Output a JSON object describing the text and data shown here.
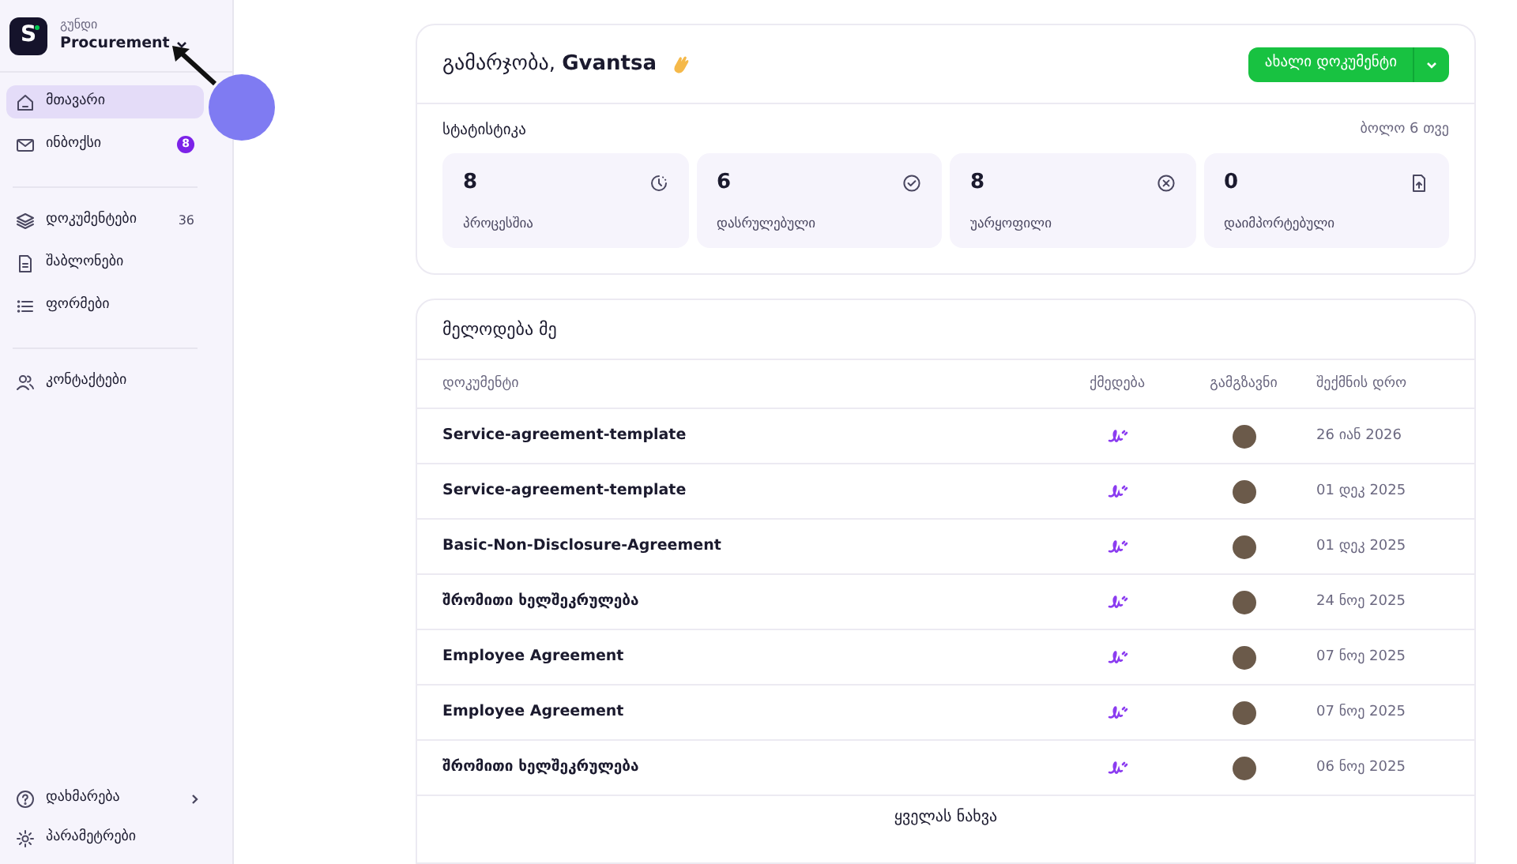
{
  "workspace": {
    "label": "გუნდი",
    "name": "Procurement",
    "logo": "S"
  },
  "nav_groups": [
    [
      {
        "label": "მთავარი",
        "selected": true
      },
      {
        "label": "ინბოქსი",
        "selected": false,
        "badge": "8"
      }
    ],
    [
      {
        "label": "დოკუმენტები",
        "selected": false,
        "count": "36"
      },
      {
        "label": "შაბლონები",
        "selected": false
      },
      {
        "label": "ფორმები",
        "selected": false
      }
    ],
    [
      {
        "label": "კონტაქტები",
        "selected": false
      }
    ]
  ],
  "nav_footer": [
    {
      "label": "დახმარება",
      "expandable": true
    },
    {
      "label": "პარამეტრები",
      "expandable": false
    }
  ],
  "greeting": "გამარჯობა, **Gvantsa**",
  "new_button": {
    "label": "ახალი დოკუმენტი"
  },
  "stats": {
    "title": "სტატისტიკა",
    "period": "ბოლო 6 თვე",
    "cards": [
      {
        "value": "8",
        "label": "პროცესშია"
      },
      {
        "value": "6",
        "label": "დასრულებული"
      },
      {
        "value": "8",
        "label": "უარყოფილი"
      },
      {
        "value": "0",
        "label": "დაიმპორტებული"
      }
    ]
  },
  "waiting": {
    "title": "მელოდება მე",
    "columns": [
      "დოკუმენტი",
      "ქმედება",
      "გამგზავნი",
      "შექმნის დრო"
    ],
    "rows": [
      {
        "document": "Service-agreement-template",
        "created": "26 იან 2026"
      },
      {
        "document": "Service-agreement-template",
        "created": "01 დეკ 2025"
      },
      {
        "document": "Basic-Non-Disclosure-Agreement",
        "created": "01 დეკ 2025"
      },
      {
        "document": "შრომითი ხელშეკრულება",
        "created": "24 ნოე 2025"
      },
      {
        "document": "Employee Agreement",
        "created": "07 ნოე 2025"
      },
      {
        "document": "Employee Agreement",
        "created": "07 ნოე 2025"
      },
      {
        "document": "შრომითი ხელშეკრულება",
        "created": "06 ნოე 2025"
      }
    ],
    "footer_link": "ყველას ნახვა"
  }
}
